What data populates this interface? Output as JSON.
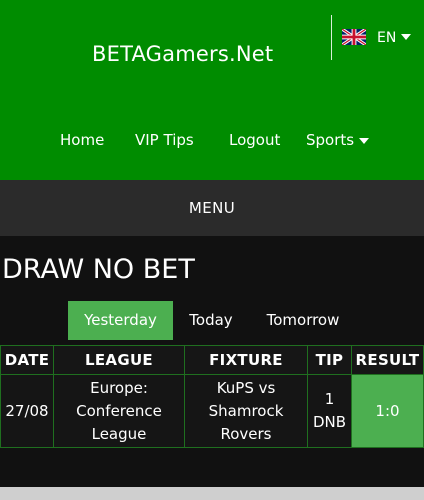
{
  "header": {
    "site_title": "BETAGamers.Net",
    "language": {
      "label": "EN",
      "flag_icon": "uk-flag-icon"
    },
    "nav": [
      {
        "label": "Home"
      },
      {
        "label": "VIP Tips"
      },
      {
        "label": "Logout"
      },
      {
        "label": "Sports",
        "icon": "caret-down-icon"
      }
    ]
  },
  "menu": {
    "label": "MENU"
  },
  "page": {
    "title": "DRAW NO BET"
  },
  "tabs": [
    {
      "label": "Yesterday",
      "active": true
    },
    {
      "label": "Today",
      "active": false
    },
    {
      "label": "Tomorrow",
      "active": false
    }
  ],
  "table": {
    "headers": [
      "DATE",
      "LEAGUE",
      "FIXTURE",
      "TIP",
      "RESULT"
    ],
    "rows": [
      {
        "date": "27/08",
        "league": "Europe: Conference League",
        "fixture": "KuPS vs Shamrock Rovers",
        "tip": "1 DNB",
        "result": "1:0"
      }
    ]
  },
  "colors": {
    "header_green": "#008c00",
    "active_green": "#4caf50",
    "menu_bar": "#2b2b2b",
    "background": "#111111"
  }
}
